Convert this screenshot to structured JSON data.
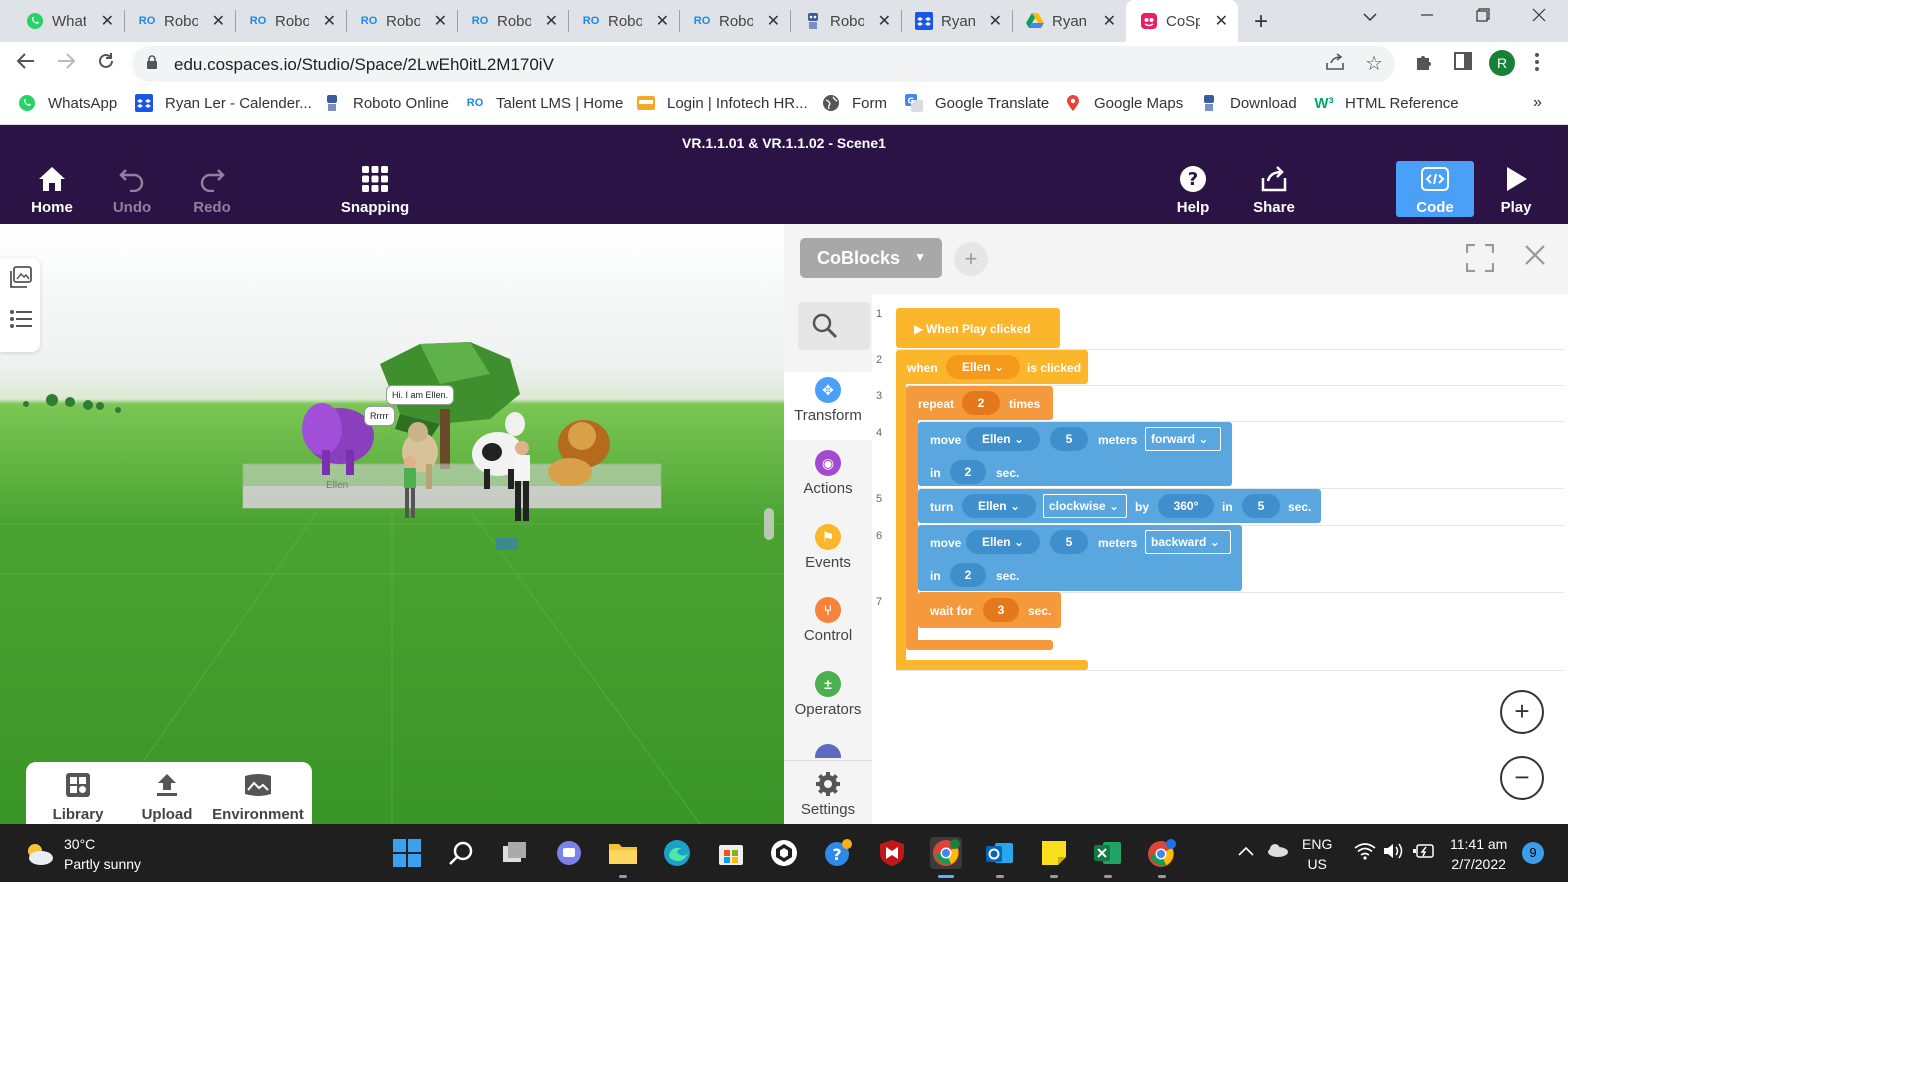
{
  "browser": {
    "tabs": [
      {
        "title": "WhatsApp",
        "icon": "whatsapp-icon",
        "color": "#25d366"
      },
      {
        "title": "Roboto Coding",
        "icon": "roboto-coding-icon",
        "color": "#1e88e5"
      },
      {
        "title": "Roboto Coding",
        "icon": "roboto-coding-icon",
        "color": "#1e88e5"
      },
      {
        "title": "Roboto Coding",
        "icon": "roboto-coding-icon",
        "color": "#1e88e5"
      },
      {
        "title": "Roboto Coding",
        "icon": "roboto-coding-icon",
        "color": "#1e88e5"
      },
      {
        "title": "Roboto Coding",
        "icon": "roboto-coding-icon",
        "color": "#1e88e5"
      },
      {
        "title": "Roboto Coding",
        "icon": "roboto-coding-icon",
        "color": "#1e88e5"
      },
      {
        "title": "Roboto",
        "icon": "roboto-robot-icon",
        "color": "#3a5ba0"
      },
      {
        "title": "Ryan",
        "icon": "dropbox-calendar-icon",
        "color": "#1a56e8"
      },
      {
        "title": "Ryan",
        "icon": "google-drive-icon",
        "color": "#fbbc04"
      },
      {
        "title": "CoSpaces",
        "icon": "cospaces-icon",
        "color": "#e91e63",
        "active": true
      }
    ],
    "url": "edu.cospaces.io/Studio/Space/2LwEh0itL2M170iV",
    "profile_initial": "R",
    "bookmarks": [
      {
        "label": "WhatsApp",
        "icon": "whatsapp-icon"
      },
      {
        "label": "Ryan Ler - Calender...",
        "icon": "dropbox-calendar-icon"
      },
      {
        "label": "Roboto Online",
        "icon": "roboto-robot-icon"
      },
      {
        "label": "Talent LMS | Home",
        "icon": "roboto-coding-icon"
      },
      {
        "label": "Login | Infotech HR...",
        "icon": "infotech-icon"
      },
      {
        "label": "Form",
        "icon": "globe-icon"
      },
      {
        "label": "Google Translate",
        "icon": "google-translate-icon"
      },
      {
        "label": "Google Maps",
        "icon": "google-maps-icon"
      },
      {
        "label": "Download",
        "icon": "roboto-robot-icon"
      },
      {
        "label": "HTML Reference",
        "icon": "w3schools-icon"
      }
    ]
  },
  "header": {
    "scene_title": "VR.1.1.01 & VR.1.1.02 - Scene1",
    "home": "Home",
    "undo": "Undo",
    "redo": "Redo",
    "snapping": "Snapping",
    "help": "Help",
    "share": "Share",
    "code": "Code",
    "play": "Play"
  },
  "scene": {
    "bubble_ellen": "Hi. I am Ellen.",
    "bubble_lion": "Rrrrr",
    "character_label": "Ellen",
    "library": "Library",
    "upload": "Upload",
    "environment": "Environment"
  },
  "code_panel": {
    "dropdown": "CoBlocks",
    "palette": {
      "transform": "Transform",
      "actions": "Actions",
      "events": "Events",
      "control": "Control",
      "operators": "Operators",
      "settings": "Settings"
    },
    "line_numbers": [
      "1",
      "2",
      "3",
      "4",
      "5",
      "6",
      "7"
    ],
    "blocks": {
      "when_play": "When Play clicked",
      "when": "when",
      "ellen": "Ellen",
      "is_clicked": "is clicked",
      "repeat": "repeat",
      "repeat_count": "2",
      "times": "times",
      "move": "move",
      "move1_dist": "5",
      "meters": "meters",
      "forward": "forward",
      "in": "in",
      "move1_time": "2",
      "sec": "sec.",
      "turn": "turn",
      "clockwise": "clockwise",
      "by": "by",
      "turn_angle": "360°",
      "turn_time": "5",
      "move2_dist": "5",
      "backward": "backward",
      "move2_time": "2",
      "wait_for": "wait for",
      "wait_time": "3"
    }
  },
  "taskbar": {
    "temperature": "30°C",
    "weather_text": "Partly sunny",
    "lang": "ENG",
    "region": "US",
    "time": "11:41 am",
    "date": "2/7/2022",
    "notifications": "9"
  },
  "colors": {
    "header_bg": "#2b1345",
    "code_button": "#4aa0f6",
    "block_yellow": "#fbb62b",
    "block_orange": "#f59a3c",
    "block_blue": "#5aa7e0",
    "grass": "#4aa331"
  }
}
